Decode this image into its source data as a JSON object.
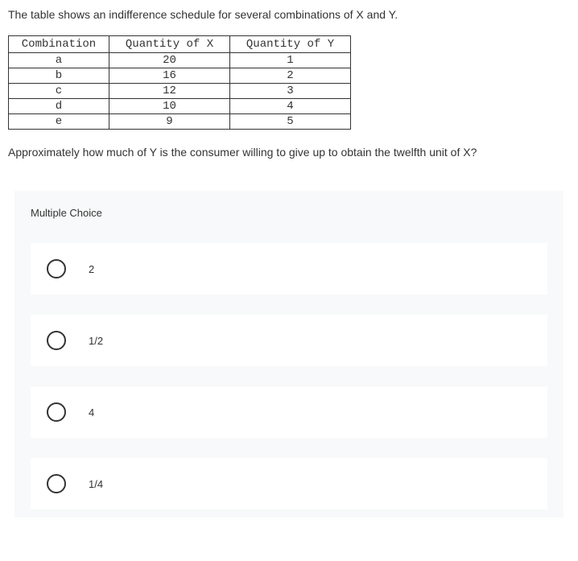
{
  "intro": "The table shows an indifference schedule for several combinations of X and Y.",
  "table": {
    "headers": [
      "Combination",
      "Quantity of X",
      "Quantity of Y"
    ],
    "rows": [
      {
        "combo": "a",
        "x": "20",
        "y": "1"
      },
      {
        "combo": "b",
        "x": "16",
        "y": "2"
      },
      {
        "combo": "c",
        "x": "12",
        "y": "3"
      },
      {
        "combo": "d",
        "x": "10",
        "y": "4"
      },
      {
        "combo": "e",
        "x": "9",
        "y": "5"
      }
    ]
  },
  "question": "Approximately how much of Y is the consumer willing to give up to obtain the twelfth unit of X?",
  "section_label": "Multiple Choice",
  "choices": [
    {
      "label": "2"
    },
    {
      "label": "1/2"
    },
    {
      "label": "4"
    },
    {
      "label": "1/4"
    }
  ]
}
